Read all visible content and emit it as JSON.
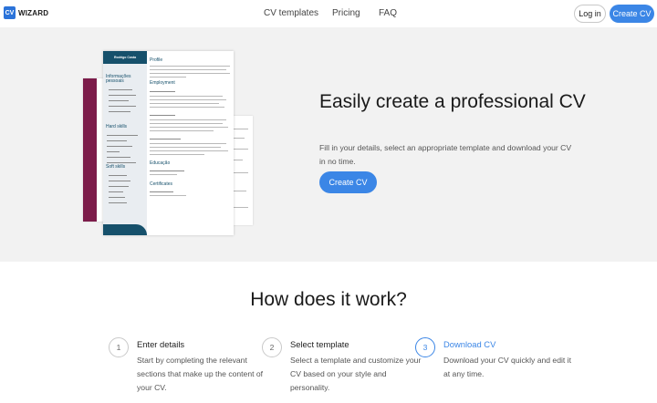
{
  "header": {
    "logo_mark": "CV",
    "logo_text": "WIZARD",
    "nav": [
      "CV templates",
      "Pricing",
      "FAQ"
    ],
    "login_label": "Log in",
    "create_label": "Create CV"
  },
  "hero": {
    "title": "Easily create a professional CV",
    "subtitle": "Fill in your details, select an appropriate template and download your CV in no time.",
    "cta_label": "Create CV",
    "cv_preview": {
      "name": "Rodrigo Costa",
      "side_heading_1": "Informações pessoais",
      "side_heading_2": "Hard skills",
      "side_heading_3": "Soft skills",
      "main_heading_1": "Profile",
      "main_heading_2": "Employment",
      "main_heading_3": "Educação",
      "main_heading_4": "Certificates"
    }
  },
  "how": {
    "title": "How does it work?",
    "steps": [
      {
        "number": "1",
        "title": "Enter details",
        "desc": "Start by completing the relevant sections that make up the content of your CV."
      },
      {
        "number": "2",
        "title": "Select template",
        "desc": "Select a template and customize your CV based on your style and personality."
      },
      {
        "number": "3",
        "title": "Download CV",
        "desc": "Download your CV quickly and edit it at any time."
      }
    ]
  },
  "colors": {
    "accent": "#3b86e6",
    "hero_bg": "#f2f2f2",
    "cv_header": "#16506b",
    "cv_back_strip": "#7c1c4a"
  }
}
